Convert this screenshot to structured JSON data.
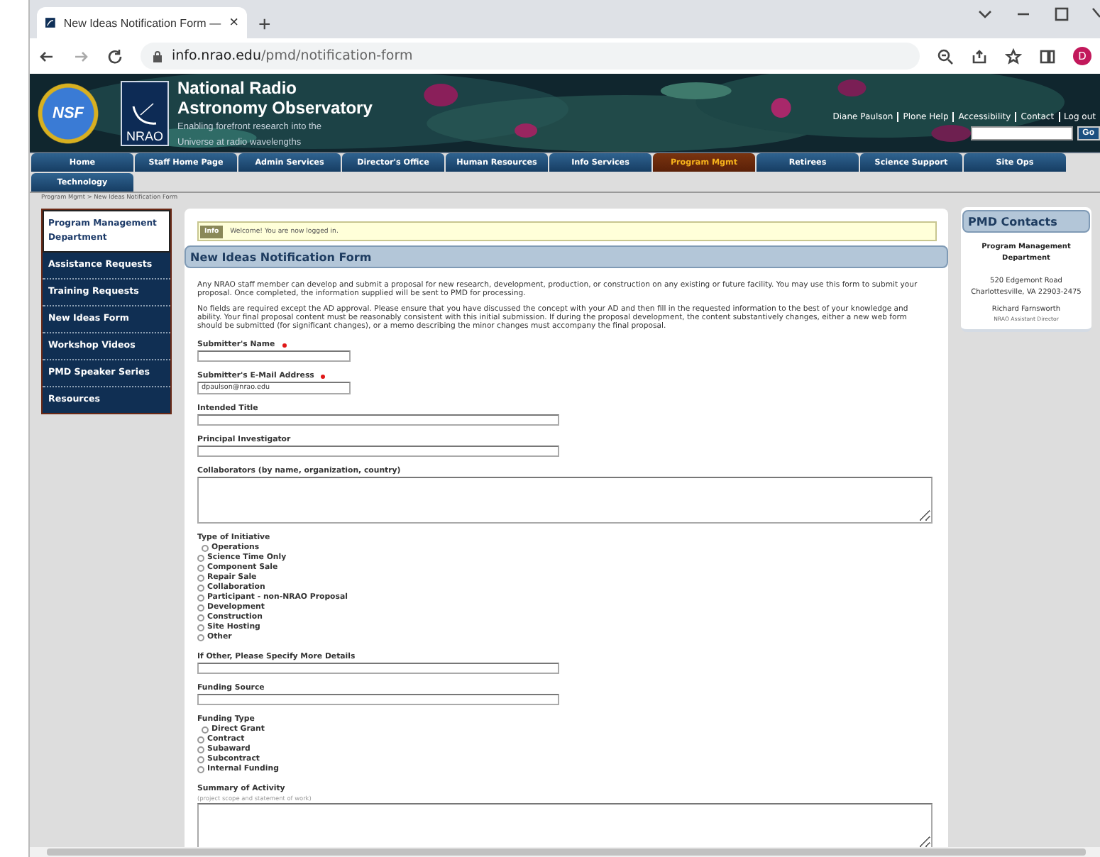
{
  "browser": {
    "tab_title": "New Ideas Notification Form —",
    "tab_close": "×",
    "new_tab": "+",
    "url_host": "info.nrao.edu",
    "url_path": "/pmd/notification-form",
    "profile": "D"
  },
  "banner": {
    "nsf": "NSF",
    "nrao": "NRAO",
    "title_lines": [
      "National Radio",
      "Astronomy Observatory"
    ],
    "tagline_lines": [
      "Enabling forefront research into the",
      "Universe at radio wavelengths"
    ],
    "user_links": [
      "Diane Paulson",
      "Plone Help",
      "Accessibility",
      "Contact",
      "Log out"
    ],
    "search_button": "Go"
  },
  "nav": [
    {
      "label": "Home",
      "selected": false
    },
    {
      "label": "Staff Home Page",
      "selected": false
    },
    {
      "label": "Admin Services",
      "selected": false
    },
    {
      "label": "Director's Office",
      "selected": false
    },
    {
      "label": "Human Resources",
      "selected": false
    },
    {
      "label": "Info Services",
      "selected": false
    },
    {
      "label": "Program Mgmt",
      "selected": true
    },
    {
      "label": "Retirees",
      "selected": false
    },
    {
      "label": "Science Support",
      "selected": false
    },
    {
      "label": "Site Ops",
      "selected": false
    },
    {
      "label": "Technology",
      "selected": false
    }
  ],
  "breadcrumb": "Program Mgmt > New Ideas Notification Form",
  "sidebar": [
    {
      "label": "Program Management Department",
      "selected": true
    },
    {
      "label": "Assistance Requests",
      "selected": false
    },
    {
      "label": "Training Requests",
      "selected": false
    },
    {
      "label": "New Ideas Form",
      "selected": false
    },
    {
      "label": "Workshop Videos",
      "selected": false
    },
    {
      "label": "PMD Speaker Series",
      "selected": false
    },
    {
      "label": "Resources",
      "selected": false
    }
  ],
  "notice": {
    "tag": "Info",
    "message": "Welcome! You are now logged in."
  },
  "form": {
    "title": "New Ideas Notification Form",
    "intro": [
      "Any NRAO staff member can develop and submit a proposal for new research, development, production, or construction on any existing or future facility. You may use this form to submit your proposal. Once completed, the information supplied will be sent to PMD for processing.",
      "No fields are required except the AD approval. Please ensure that you have discussed the concept with your AD and then fill in the requested information to the best of your knowledge and ability. Your final proposal content must be reasonably consistent with this initial submission. If during the proposal development, the content substantively changes, either a new web form should be submitted (for significant changes), or a memo describing the minor changes must accompany the final proposal."
    ],
    "fields": [
      {
        "kind": "short",
        "label": "Submitter's Name",
        "required": true
      },
      {
        "kind": "short",
        "label": "Submitter's E-Mail Address",
        "required": true,
        "value": "dpaulson@nrao.edu"
      },
      {
        "kind": "text",
        "label": "Intended Title",
        "required": false
      },
      {
        "kind": "text",
        "label": "Principal Investigator",
        "required": false
      },
      {
        "kind": "textarea",
        "label": "Collaborators (by name, organization, country)",
        "required": false
      },
      {
        "kind": "radio",
        "label": "Type of Initiative",
        "required": false,
        "options": [
          {
            "label": "Operations",
            "selected": false
          },
          {
            "label": "Science Time Only",
            "selected": false
          },
          {
            "label": "Component Sale",
            "selected": false
          },
          {
            "label": "Repair Sale",
            "selected": false
          },
          {
            "label": "Collaboration",
            "selected": false
          },
          {
            "label": "Participant - non-NRAO Proposal",
            "selected": false
          },
          {
            "label": "Development",
            "selected": false
          },
          {
            "label": "Construction",
            "selected": false
          },
          {
            "label": "Site Hosting",
            "selected": false
          },
          {
            "label": "Other",
            "selected": false
          }
        ]
      },
      {
        "kind": "text",
        "label": "If Other, Please Specify More Details",
        "required": false
      },
      {
        "kind": "text",
        "label": "Funding Source",
        "required": false
      },
      {
        "kind": "radio",
        "label": "Funding Type",
        "required": false,
        "options": [
          {
            "label": "Direct Grant",
            "selected": false
          },
          {
            "label": "Contract",
            "selected": false
          },
          {
            "label": "Subaward",
            "selected": false
          },
          {
            "label": "Subcontract",
            "selected": false
          },
          {
            "label": "Internal Funding",
            "selected": false
          }
        ]
      },
      {
        "kind": "textarea",
        "label": "Summary of Activity",
        "required": false,
        "hint": "(project scope and statement of work)"
      }
    ]
  },
  "contacts": {
    "title": "PMD Contacts",
    "department": "Program Management Department",
    "address_lines": [
      "520 Edgemont Road",
      "Charlottesville, VA 22903-2475"
    ],
    "name": "Richard Farnsworth",
    "role": "NRAO Assistant Director"
  }
}
